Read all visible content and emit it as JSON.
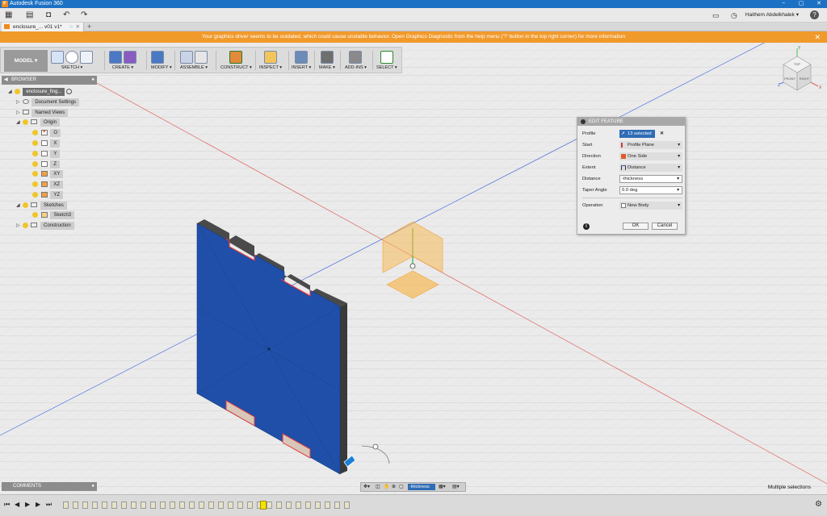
{
  "title_bar": {
    "app_icon": "F",
    "title": "Autodesk Fusion 360",
    "minimize": "−",
    "restore": "▢",
    "close": "✕"
  },
  "qat": {
    "user_name": "Haithem Abdelkhalek ▾",
    "help": "?"
  },
  "tabs": [
    {
      "label": "enclosure_... v01 v1*"
    }
  ],
  "warning": {
    "message": "Your graphics driver seems to be outdated, which could cause unstable behavior. Open Graphics Diagnostic from the help menu ('?' button in the top right corner) for more information"
  },
  "toolbar": {
    "mode": "MODEL ▾",
    "groups": [
      {
        "label": "SKETCH ▾",
        "icon": "sketch-icon"
      },
      {
        "label": "CREATE ▾",
        "icon": "create-icon"
      },
      {
        "label": "MODIFY ▾",
        "icon": "modify-icon"
      },
      {
        "label": "ASSEMBLE ▾",
        "icon": "assemble-icon"
      },
      {
        "label": "CONSTRUCT ▾",
        "icon": "construct-icon"
      },
      {
        "label": "INSPECT ▾",
        "icon": "inspect-icon"
      },
      {
        "label": "INSERT ▾",
        "icon": "insert-icon"
      },
      {
        "label": "MAKE ▾",
        "icon": "make-icon"
      },
      {
        "label": "ADD-INS ▾",
        "icon": "addins-icon"
      },
      {
        "label": "SELECT ▾",
        "icon": "select-icon"
      }
    ]
  },
  "browser": {
    "title": "BROWSER",
    "items": [
      {
        "label": "enclosure_fing...",
        "expander": "◢"
      },
      {
        "label": "Document Settings",
        "expander": "▷"
      },
      {
        "label": "Named Views",
        "expander": "▷"
      },
      {
        "label": "Origin",
        "expander": "◢"
      },
      {
        "label": "O"
      },
      {
        "label": "X"
      },
      {
        "label": "Y"
      },
      {
        "label": "Z"
      },
      {
        "label": "XY"
      },
      {
        "label": "XZ"
      },
      {
        "label": "YZ"
      },
      {
        "label": "Sketches",
        "expander": "◢"
      },
      {
        "label": "Sketch3"
      },
      {
        "label": "Construction",
        "expander": "▷"
      }
    ]
  },
  "dialog": {
    "title": "EDIT FEATURE",
    "profile_label": "Profile",
    "profile_value": "13 selected",
    "start_label": "Start",
    "start_value": "Profile Plane",
    "direction_label": "Direction",
    "direction_value": "One Side",
    "extent_label": "Extent",
    "extent_value": "Distance",
    "distance_label": "Distance",
    "distance_value": "-thickness",
    "taper_label": "Taper Angle",
    "taper_value": "0.0 deg",
    "operation_label": "Operation",
    "operation_value": "New Body",
    "ok": "OK",
    "cancel": "Cancel",
    "info": "i"
  },
  "comments": {
    "title": "COMMENTS"
  },
  "navbar": {
    "input_value": "-thickness"
  },
  "status": {
    "text": "Multiple selections"
  },
  "viewcube": {
    "top": "TOP",
    "front": "FRONT",
    "right": "RIGHT",
    "x": "X",
    "y": "Y",
    "z": "Z"
  },
  "colors": {
    "accent": "#1d71c4",
    "warning": "#f19a2c",
    "body": "#1f4fa8",
    "dialog_pill": "#2f6cb5"
  }
}
